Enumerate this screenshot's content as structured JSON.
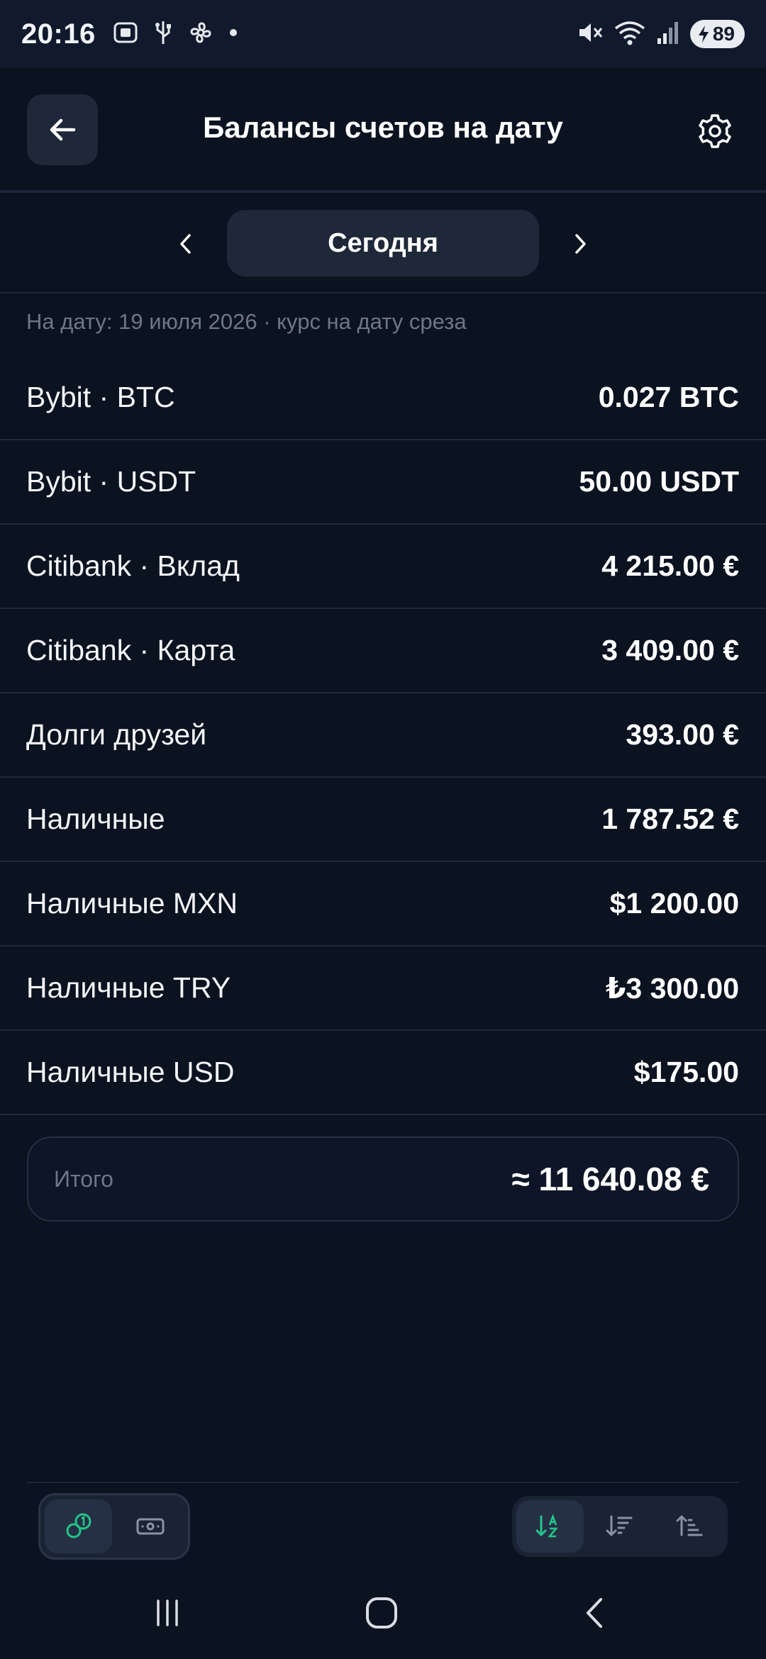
{
  "status_bar": {
    "time": "20:16",
    "battery": "89",
    "icons": [
      "screenshot-icon",
      "usb-icon",
      "fan-icon",
      "dot-icon",
      "mute-icon",
      "wifi-icon",
      "signal-icon",
      "battery-icon"
    ]
  },
  "header": {
    "title": "Балансы счетов на дату",
    "back_icon": "arrow-left-icon",
    "settings_icon": "gear-icon"
  },
  "date_selector": {
    "label": "Сегодня"
  },
  "caption": "На дату: 19 июля 2026 · курс на дату среза",
  "accounts": [
    {
      "name": "Bybit · BTC",
      "amount": "0.027 BTC"
    },
    {
      "name": "Bybit · USDT",
      "amount": "50.00 USDT"
    },
    {
      "name": "Citibank · Вклад",
      "amount": "4 215.00 €"
    },
    {
      "name": "Citibank · Карта",
      "amount": "3 409.00 €"
    },
    {
      "name": "Долги друзей",
      "amount": "393.00 €"
    },
    {
      "name": "Наличные",
      "amount": "1 787.52 €"
    },
    {
      "name": "Наличные MXN",
      "amount": "$1 200.00"
    },
    {
      "name": "Наличные TRY",
      "amount": "₺3 300.00"
    },
    {
      "name": "Наличные USD",
      "amount": "$175.00"
    }
  ],
  "total": {
    "label": "Итого",
    "value": "≈ 11 640.08 €"
  },
  "colors": {
    "background": "#0b1220",
    "card": "#1e2838",
    "accent_green": "#22c58b",
    "muted_text": "#6d7789"
  }
}
